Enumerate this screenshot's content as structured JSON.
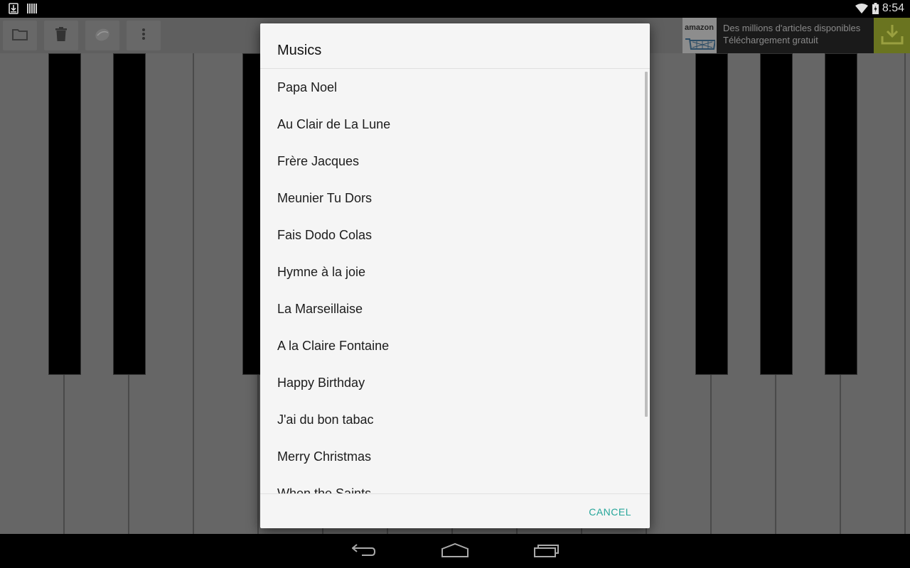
{
  "status_bar": {
    "left_icons": [
      "download-notification-icon",
      "barcode-notification-icon"
    ],
    "right_icons": [
      "wifi-icon",
      "battery-charging-icon"
    ],
    "time": "8:54"
  },
  "toolbar": {
    "buttons": [
      {
        "icon": "folder-icon",
        "label": "Open"
      },
      {
        "icon": "trash-icon",
        "label": "Delete"
      },
      {
        "icon": "record-icon",
        "label": "Record"
      },
      {
        "icon": "overflow-menu-icon",
        "label": "More options"
      }
    ]
  },
  "ad": {
    "brand": "amazon",
    "line1": "Des millions d'articles disponibles",
    "line2": "Téléchargement gratuit",
    "download_icon": "download-icon",
    "accent_color": "#6a7420"
  },
  "dialog": {
    "title": "Musics",
    "items": [
      "Papa Noel",
      "Au Clair de La Lune",
      "Frère Jacques",
      "Meunier Tu Dors",
      "Fais Dodo Colas",
      "Hymne à la joie",
      "La Marseillaise",
      "A la Claire Fontaine",
      "Happy Birthday",
      "J'ai du bon tabac",
      "Merry Christmas",
      "When the Saints"
    ],
    "cancel_label": "CANCEL",
    "accent_color": "#26a69a"
  },
  "nav_bar": {
    "buttons": [
      {
        "icon": "back-icon",
        "label": "Back"
      },
      {
        "icon": "home-icon",
        "label": "Home"
      },
      {
        "icon": "recent-apps-icon",
        "label": "Recent apps"
      }
    ]
  }
}
